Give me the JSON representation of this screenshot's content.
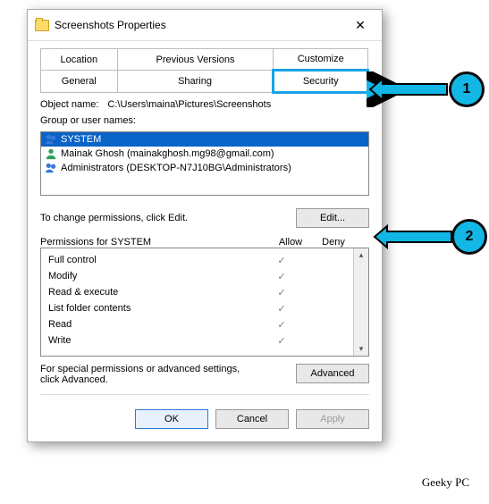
{
  "title": "Screenshots Properties",
  "tabs": {
    "row1": [
      "Location",
      "Previous Versions",
      "Customize"
    ],
    "row2": [
      "General",
      "Sharing",
      "Security"
    ],
    "active": "Security"
  },
  "object_label": "Object name:",
  "object_path": "C:\\Users\\maina\\Pictures\\Screenshots",
  "group_label": "Group or user names:",
  "users": [
    {
      "name": "SYSTEM",
      "sel": true,
      "kind": "group"
    },
    {
      "name": "Mainak Ghosh (mainakghosh.mg98@gmail.com)",
      "sel": false,
      "kind": "user"
    },
    {
      "name": "Administrators (DESKTOP-N7J10BG\\Administrators)",
      "sel": false,
      "kind": "group"
    }
  ],
  "edit_hint": "To change permissions, click Edit.",
  "edit_btn": "Edit...",
  "perm_header": "Permissions for SYSTEM",
  "cols": {
    "allow": "Allow",
    "deny": "Deny"
  },
  "perms": [
    {
      "n": "Full control",
      "a": true,
      "d": false
    },
    {
      "n": "Modify",
      "a": true,
      "d": false
    },
    {
      "n": "Read & execute",
      "a": true,
      "d": false
    },
    {
      "n": "List folder contents",
      "a": true,
      "d": false
    },
    {
      "n": "Read",
      "a": true,
      "d": false
    },
    {
      "n": "Write",
      "a": true,
      "d": false
    }
  ],
  "adv_hint": "For special permissions or advanced settings, click Advanced.",
  "adv_btn": "Advanced",
  "buttons": {
    "ok": "OK",
    "cancel": "Cancel",
    "apply": "Apply"
  },
  "annot": {
    "1": "1",
    "2": "2"
  },
  "watermark": "Geeky PC"
}
